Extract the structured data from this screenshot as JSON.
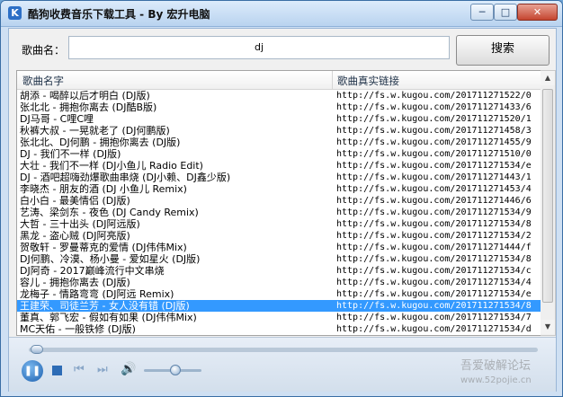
{
  "window": {
    "title": "酷狗收费音乐下载工具 - By 宏升电脑",
    "app_icon_glyph": "K",
    "minimize_glyph": "─",
    "maximize_glyph": "□",
    "close_glyph": "✕"
  },
  "search": {
    "label": "歌曲名：",
    "value": "dj",
    "button_label": "搜索"
  },
  "list": {
    "columns": [
      "歌曲名字",
      "歌曲真实链接"
    ],
    "selected_index": 18,
    "rows": [
      {
        "name": "胡添 - 喝醉以后才明白 (DJ版)",
        "link": "http://fs.w.kugou.com/201711271522/0"
      },
      {
        "name": "张北北 - 拥抱你离去 (DJ酷B版)",
        "link": "http://fs.w.kugou.com/201711271433/6"
      },
      {
        "name": "DJ马哥 - C哩C哩",
        "link": "http://fs.w.kugou.com/201711271520/1"
      },
      {
        "name": "秋裤大叔 - 一晃就老了 (DJ何鹏版)",
        "link": "http://fs.w.kugou.com/201711271458/3"
      },
      {
        "name": "张北北、DJ何鹏 - 拥抱你离去 (DJ版)",
        "link": "http://fs.w.kugou.com/201711271455/9"
      },
      {
        "name": "DJ - 我们不一样 (DJ版)",
        "link": "http://fs.w.kugou.com/201711271510/0"
      },
      {
        "name": "大壮 - 我们不一样 (DJ小鱼儿 Radio Edit)",
        "link": "http://fs.w.kugou.com/201711271534/e"
      },
      {
        "name": "DJ - 酒吧超嗨劲爆歌曲串烧 (DJ小赖、DJ鑫少版)",
        "link": "http://fs.w.kugou.com/201711271443/1"
      },
      {
        "name": "李晓杰 - 朋友的酒 (DJ 小鱼儿 Remix)",
        "link": "http://fs.w.kugou.com/201711271453/4"
      },
      {
        "name": "白小白 - 最美情侣 (DJ版)",
        "link": "http://fs.w.kugou.com/201711271446/6"
      },
      {
        "name": "艺涛、梁剑东 - 夜色 (DJ Candy Remix)",
        "link": "http://fs.w.kugou.com/201711271534/9"
      },
      {
        "name": "大哲 - 三十出头 (DJ阿远版)",
        "link": "http://fs.w.kugou.com/201711271534/8"
      },
      {
        "name": "黑龙 - 盗心贼 (DJ阿亮版)",
        "link": "http://fs.w.kugou.com/201711271534/2"
      },
      {
        "name": "贺敬轩 - 罗曼蒂克的爱情 (DJ伟伟Mix)",
        "link": "http://fs.w.kugou.com/201711271444/f"
      },
      {
        "name": "DJ何鹏、冷漠、杨小曼 - 爱如星火 (DJ版)",
        "link": "http://fs.w.kugou.com/201711271534/8"
      },
      {
        "name": "DJ阿奇 - 2017巅峰流行中文串烧",
        "link": "http://fs.w.kugou.com/201711271534/c"
      },
      {
        "name": "容儿 - 拥抱你离去 (DJ版)",
        "link": "http://fs.w.kugou.com/201711271534/4"
      },
      {
        "name": "龙梅子 - 情路弯弯 (DJ阿远 Remix)",
        "link": "http://fs.w.kugou.com/201711271534/e"
      },
      {
        "name": "王建荣、司徒兰芳 - 女人没有错 (DJ版)",
        "link": "http://fs.w.kugou.com/201711271534/8"
      },
      {
        "name": "董真、郭飞宏 - 假如有如果 (DJ伟伟Mix)",
        "link": "http://fs.w.kugou.com/201711271534/7"
      },
      {
        "name": "MC天佑 - 一般铁修 (DJ版)",
        "link": "http://fs.w.kugou.com/201711271534/d"
      }
    ]
  },
  "scrollbar": {
    "up_glyph": "▲",
    "down_glyph": "▼"
  },
  "player": {
    "play_pause_glyph": "❚❚",
    "prev_glyph": "⏮",
    "next_glyph": "⏭",
    "volume_glyph": "🔊",
    "seek_progress": 0.0,
    "volume_level": 0.55
  },
  "watermark": {
    "text": "吾爱破解论坛",
    "url": "www.52pojie.cn"
  }
}
